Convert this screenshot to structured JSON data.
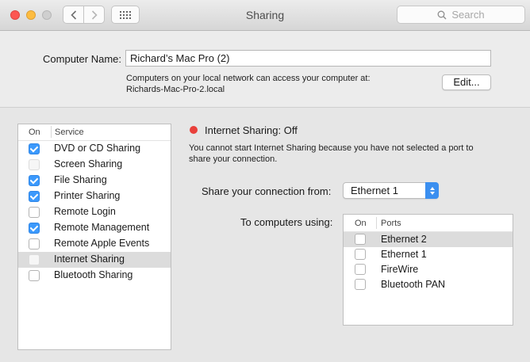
{
  "window": {
    "title": "Sharing"
  },
  "search": {
    "placeholder": "Search"
  },
  "computer_name": {
    "label": "Computer Name:",
    "value": "Richard’s Mac Pro (2)",
    "info_line1": "Computers on your local network can access your computer at:",
    "info_line2": "Richards-Mac-Pro-2.local",
    "edit_label": "Edit..."
  },
  "services": {
    "header_on": "On",
    "header_service": "Service",
    "items": [
      {
        "label": "DVD or CD Sharing",
        "checked": true,
        "enabled": true,
        "selected": false
      },
      {
        "label": "Screen Sharing",
        "checked": false,
        "enabled": false,
        "selected": false
      },
      {
        "label": "File Sharing",
        "checked": true,
        "enabled": true,
        "selected": false
      },
      {
        "label": "Printer Sharing",
        "checked": true,
        "enabled": true,
        "selected": false
      },
      {
        "label": "Remote Login",
        "checked": false,
        "enabled": true,
        "selected": false
      },
      {
        "label": "Remote Management",
        "checked": true,
        "enabled": true,
        "selected": false
      },
      {
        "label": "Remote Apple Events",
        "checked": false,
        "enabled": true,
        "selected": false
      },
      {
        "label": "Internet Sharing",
        "checked": false,
        "enabled": false,
        "selected": true
      },
      {
        "label": "Bluetooth Sharing",
        "checked": false,
        "enabled": true,
        "selected": false
      }
    ]
  },
  "detail": {
    "status": "Internet Sharing: Off",
    "status_color": "#e9403b",
    "message_line1": "You cannot start Internet Sharing because you have not selected a port to",
    "message_line2": "share your connection.",
    "share_from_label": "Share your connection from:",
    "share_from_value": "Ethernet 1",
    "to_computers_label": "To computers using:",
    "ports": {
      "header_on": "On",
      "header_ports": "Ports",
      "items": [
        {
          "label": "Ethernet 2",
          "checked": false,
          "selected": true
        },
        {
          "label": "Ethernet 1",
          "checked": false,
          "selected": false
        },
        {
          "label": "FireWire",
          "checked": false,
          "selected": false
        },
        {
          "label": "Bluetooth PAN",
          "checked": false,
          "selected": false
        }
      ]
    }
  },
  "icons": {
    "back": "chevron-left-icon",
    "forward": "chevron-right-icon",
    "grid": "grid-icon",
    "search": "search-icon"
  },
  "colors": {
    "accent": "#3b99fc",
    "close": "#fc5753",
    "minimize": "#fdbc40"
  }
}
